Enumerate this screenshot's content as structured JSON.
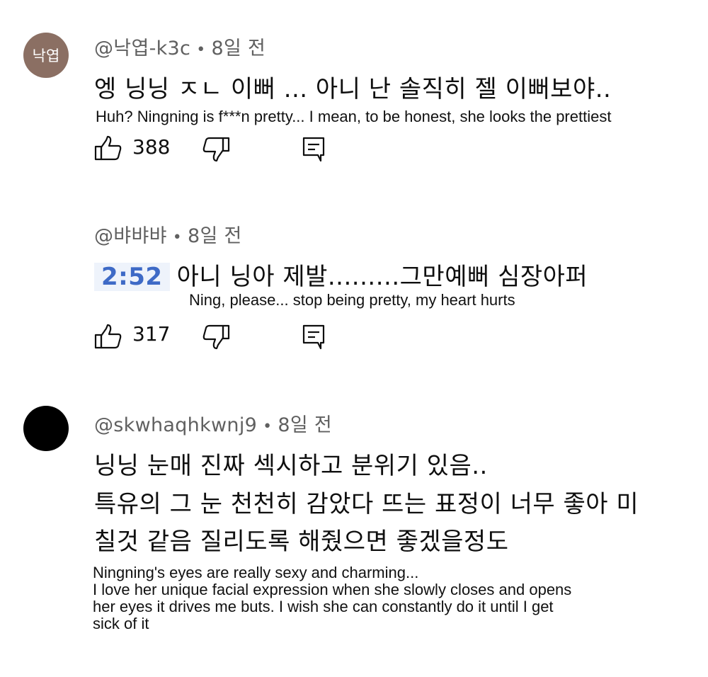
{
  "comments": [
    {
      "avatar_text": "낙엽",
      "avatar_color": "#8b6f63",
      "username": "@낙엽-k3c",
      "separator": "•",
      "time": "8일 전",
      "body": "엥 닝닝 ㅈㄴ 이뻐 ... 아니 난 솔직히 젤 이뻐보야..",
      "translation": "Huh? Ningning is f***n pretty... I mean, to be honest, she looks the prettiest",
      "likes": "388"
    },
    {
      "username": "@뱌뱌뱌",
      "separator": "•",
      "time": "8일 전",
      "timestamp_link": "2:52",
      "body": "아니 닝아 제발.........그만예뻐 심장아퍼",
      "translation": "Ning, please... stop being pretty, my heart hurts",
      "likes": "317"
    },
    {
      "avatar_color": "#000000",
      "username": "@skwhaqhkwnj9",
      "separator": "•",
      "time": "8일 전",
      "body_lines": [
        "닝닝 눈매 진짜 섹시하고 분위기 있음..",
        "특유의 그 눈 천천히 감았다 뜨는 표정이 너무 좋아 미",
        "칠것 같음 질리도록 해줬으면 좋겠을정도"
      ],
      "translation_lines": [
        "Ningning's eyes are really sexy and charming...",
        "I love her unique facial expression when she slowly closes and opens",
        "her eyes it drives me buts. I wish she can constantly do it until I get",
        "sick of it"
      ]
    }
  ],
  "colors": {
    "meta": "#606060",
    "text": "#0f0f0f",
    "timestamp_link": "#3e6ac6",
    "timestamp_bg": "#eef3fb"
  },
  "icons": [
    "thumbs-up-icon",
    "thumbs-down-icon",
    "reply-icon"
  ]
}
